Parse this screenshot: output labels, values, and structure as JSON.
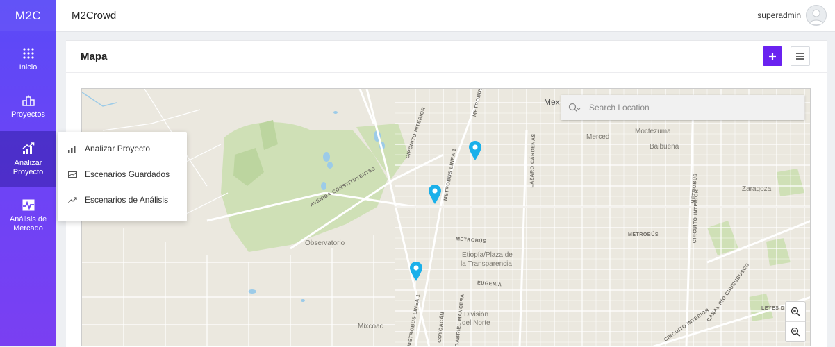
{
  "brand": "M2C",
  "topbar": {
    "title": "M2Crowd",
    "user": "superadmin"
  },
  "sidebar": {
    "items": [
      {
        "label": "Inicio",
        "icon": "grid-dots-icon"
      },
      {
        "label": "Proyectos",
        "icon": "buildings-icon"
      },
      {
        "label": "Analizar Proyecto",
        "icon": "chart-growth-icon"
      },
      {
        "label": "Análisis de Mercado",
        "icon": "pulse-chart-icon"
      }
    ]
  },
  "flyout": {
    "items": [
      {
        "label": "Analizar Proyecto",
        "icon": "bar-chart-icon"
      },
      {
        "label": "Escenarios Guardados",
        "icon": "saved-chart-icon"
      },
      {
        "label": "Escenarios de Análisis",
        "icon": "trend-line-icon"
      }
    ]
  },
  "card": {
    "title": "Mapa"
  },
  "map": {
    "search_placeholder": "Search Location",
    "places": {
      "mex": "Mex",
      "merced": "Merced",
      "moctezuma": "Moctezuma",
      "balbuena": "Balbuena",
      "zaragoza": "Zaragoza",
      "observatorio": "Observatorio",
      "etiopia": "Etiopía/Plaza de",
      "transparencia": "la Transparencia",
      "division": "División",
      "delnorte": "del Norte",
      "mixcoac": "Mixcoac"
    },
    "roads": {
      "circuito": "CIRCUITO INTERIOR",
      "metrobus_top": "METROBÚS",
      "metrobus_l1": "METROBÚS LÍNEA 1",
      "constituyentes": "AVENIDA CONSTITUYENTES",
      "lazaro": "LÁZARO CÁRDENAS",
      "metrobus_mid": "METROBÚS",
      "metrobus_right": "METROBÚS",
      "eugenia": "EUGENIA",
      "metrobus_l1b": "METROBÚS LÍNEA 1",
      "coyoacan": "COYOACÁN",
      "gabriel": "GABRIEL MANCERA",
      "circuito_right": "CIRCUITO INTERIOR",
      "canal": "CANAL RÍO CHURUBUSCO",
      "circuito_bottom": "CIRCUITO INTERIOR",
      "leyes": "LEYES DE",
      "metrobus_rv": "METROBÚS"
    },
    "pin_color": "#1ab0ea"
  },
  "colors": {
    "accent": "#6a22f0",
    "sidebar_top": "#5a4af7",
    "sidebar_bottom": "#7a3ff2"
  }
}
